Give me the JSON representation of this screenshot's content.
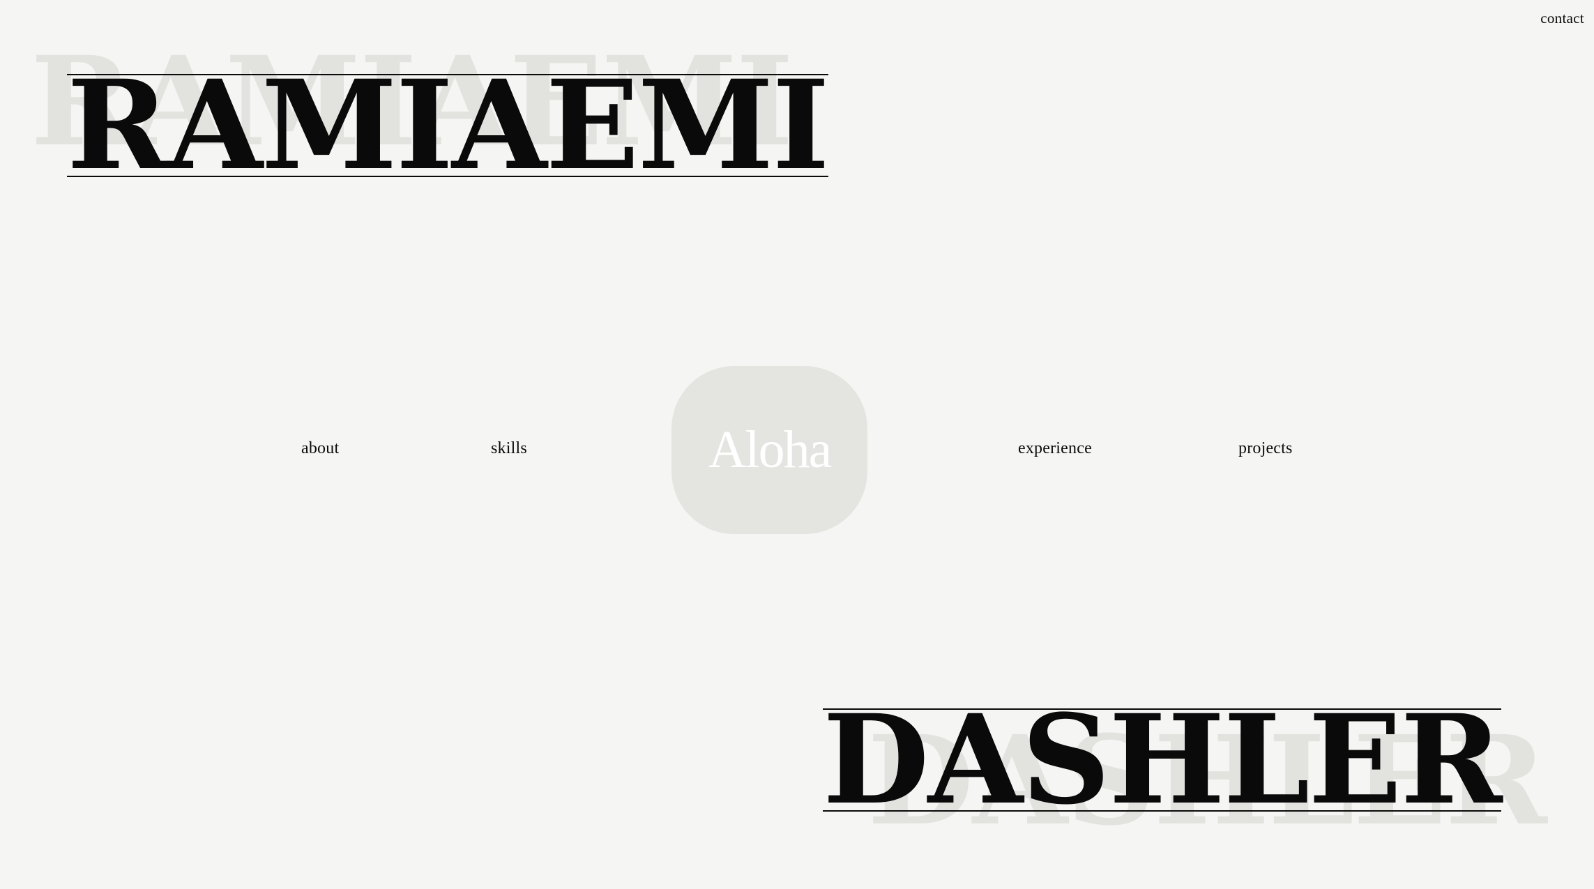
{
  "header": {
    "contact_label": "contact"
  },
  "hero": {
    "first_name": "RAMIAEMI",
    "last_name": "DASHLER",
    "greeting": "Aloha"
  },
  "nav": {
    "about": "about",
    "skills": "skills",
    "experience": "experience",
    "projects": "projects"
  },
  "colors": {
    "background": "#f5f5f3",
    "text": "#0a0a0a",
    "shadow_text": "#e2e2df",
    "tile": "#e4e4e1",
    "tile_text": "#ffffff"
  }
}
